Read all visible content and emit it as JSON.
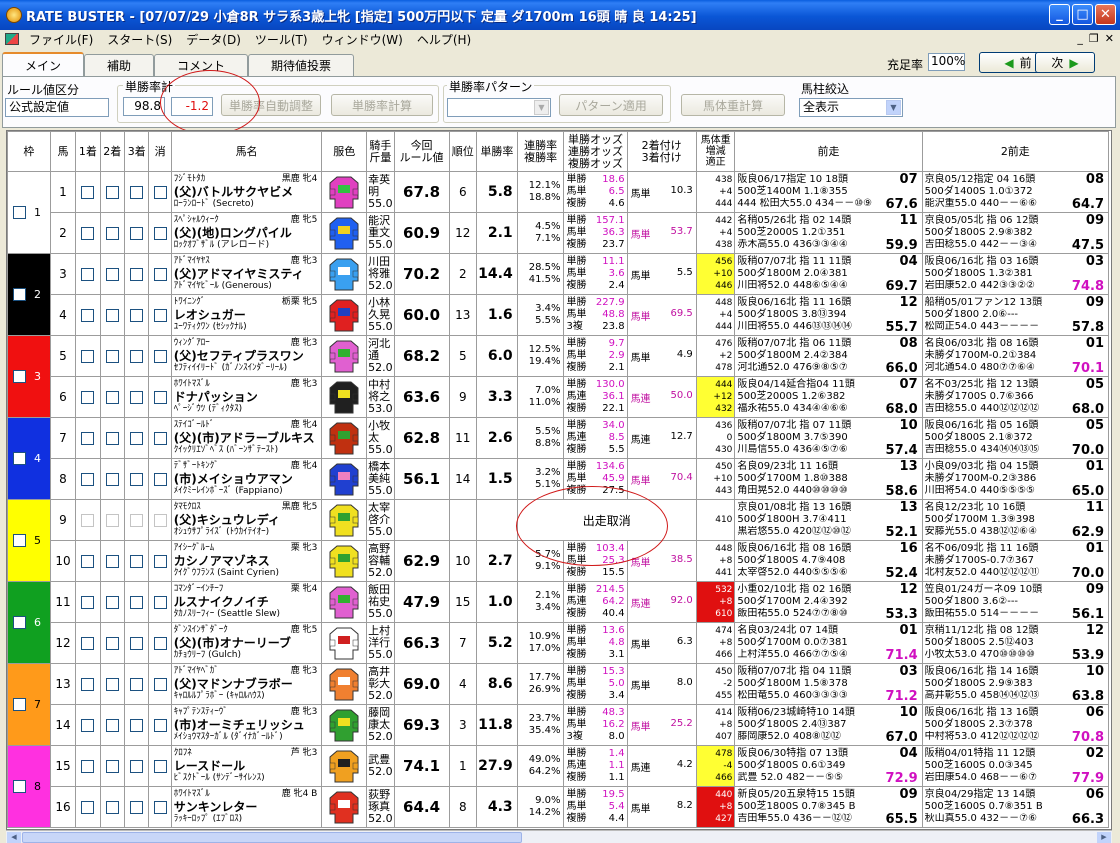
{
  "window": {
    "title": "RATE BUSTER - [07/07/29 小倉8R サラ系3歳上牝 [指定] 500万円以下 定量 ダ1700m 16頭 晴 良 14:25]"
  },
  "menu": [
    "ファイル(F)",
    "スタート(S)",
    "データ(D)",
    "ツール(T)",
    "ウィンドウ(W)",
    "ヘルプ(H)"
  ],
  "tabs": [
    "メイン",
    "補助",
    "コメント",
    "期待値投票"
  ],
  "fill_rate": {
    "label": "充足率",
    "value": "100%"
  },
  "nav": {
    "prev": "前",
    "next": "次"
  },
  "controls": {
    "rule_group_label": "ルール値区分",
    "rule_select": "公式設定値",
    "win_total_label": "単勝率計",
    "win_total": "98.8",
    "win_diff": "-1.2",
    "auto_adjust": "単勝率自動調整",
    "calc": "単勝率計算",
    "pattern_label": "単勝率パターン",
    "pattern_value": "",
    "pattern_apply": "パターン適用",
    "weight_calc": "馬体重計算",
    "filter_label": "馬柱絞込",
    "filter_value": "全表示"
  },
  "headers": {
    "waku": "枠",
    "uma": "馬",
    "p1": "1着",
    "p2": "2着",
    "p3": "3着",
    "kesi": "消",
    "name": "馬名",
    "silk": "服色",
    "jockey": "騎手\n斤量",
    "rule": "今回\nルール値",
    "rank": "順位",
    "win": "単勝率",
    "ren": "連勝率\n複勝率",
    "odds": "単勝オッズ\n連勝オッズ\n複勝オッズ",
    "pair": "2着付け\n3着付け",
    "bw": "馬体重\n増減\n適正",
    "prev1": "前走",
    "prev2": "2前走"
  },
  "scratch_text": "出走取消",
  "horses": [
    {
      "num": "1",
      "owner": "ﾌｼﾞﾓﾄﾀｶ",
      "color": "黒鹿",
      "sex": "牝4",
      "name": "(父)バトルサクヤビメ",
      "sire": "ﾛｰﾗﾝﾛｰﾄﾞ (Secreto)",
      "jockey": "幸英明",
      "kin": "55.0",
      "rule": "67.8",
      "rank": "6",
      "win": "5.8",
      "ren": "12.1%",
      "fuku": "18.8%",
      "o1": "18.6",
      "o2": "6.5",
      "o3": "4.6",
      "l1": "単勝",
      "l2": "馬単",
      "l3": "複勝",
      "pa": "10.3",
      "pb": "",
      "pm": false,
      "bw1": "438",
      "bw2": "+4",
      "bw3": "444",
      "bwc": "",
      "r1a": "阪良06/17指定 10 18頭",
      "r1k": "07",
      "r1b": "500芝1400M 1.1⑧355",
      "r1c": "444 松田大55.0 434－－⑩⑨",
      "r1s": "67.6",
      "r1m": false,
      "r2a": "京良05/12指定 04 16頭",
      "r2k": "08",
      "r2b": "500ダ1400S 1.0①372",
      "r2c": "能沢重55.0 440－－⑥⑥",
      "r2s": "64.7",
      "r2m": false,
      "s": [
        "#e040c0",
        "#30c040",
        "#e040c0"
      ]
    },
    {
      "num": "2",
      "owner": "ｽﾍﾟｼｬﾙｳｨｰｸ",
      "color": "鹿",
      "sex": "牝5",
      "name": "(父)(地)ロングパイル",
      "sire": "ﾛｯｸｵﾌﾞｻﾞﾙ (アレロード)",
      "jockey": "能沢重文",
      "kin": "55.0",
      "rule": "60.9",
      "rank": "12",
      "win": "2.1",
      "ren": "4.5%",
      "fuku": "7.1%",
      "o1": "157.1",
      "o2": "36.3",
      "o3": "23.7",
      "l1": "単勝",
      "l2": "馬単",
      "l3": "複勝",
      "pa": "53.7",
      "pb": "",
      "pm": true,
      "bw1": "442",
      "bw2": "+4",
      "bw3": "438",
      "bwc": "",
      "r1a": "名稍05/26北 指 02 14頭",
      "r1k": "11",
      "r1b": "500芝2000S 1.2①351",
      "r1c": "赤木高55.0 436③③④④",
      "r1s": "59.9",
      "r1m": false,
      "r2a": "京良05/05北 指 06 12頭",
      "r2k": "09",
      "r2b": "500ダ1800S 2.9⑧382",
      "r2c": "吉田稔55.0 442－－③④",
      "r2s": "47.5",
      "r2m": false,
      "s": [
        "#2060f0",
        "#f0d020",
        "#2060f0"
      ]
    },
    {
      "num": "3",
      "owner": "ｱﾄﾞﾏｲﾔﾔｽ",
      "color": "鹿",
      "sex": "牝3",
      "name": "(父)アドマイヤミスティ",
      "sire": "ｱﾄﾞﾏｲﾔﾋﾞｰﾙ (Generous)",
      "jockey": "川田将雅",
      "kin": "52.0",
      "rule": "70.2",
      "rank": "2",
      "win": "14.4",
      "ren": "28.5%",
      "fuku": "41.5%",
      "o1": "11.1",
      "o2": "3.6",
      "o3": "2.4",
      "l1": "単勝",
      "l2": "馬単",
      "l3": "複勝",
      "pa": "5.5",
      "pb": "",
      "pm": false,
      "bw1": "456",
      "bw2": "+10",
      "bw3": "446",
      "bwc": "y",
      "r1a": "阪稍07/07北 指 11 11頭",
      "r1k": "04",
      "r1b": "500ダ1800M 2.0④381",
      "r1c": "川田将52.0 448⑥⑤④④",
      "r1s": "69.7",
      "r1m": false,
      "r2a": "阪良06/16北 指 03 16頭",
      "r2k": "03",
      "r2b": "500ダ1800S 1.3②381",
      "r2c": "岩田康52.0 442③③②②",
      "r2s": "74.8",
      "r2m": true,
      "s": [
        "#3aa0f0",
        "#ffffff",
        "#3aa0f0"
      ]
    },
    {
      "num": "4",
      "owner": "ﾄﾜｲﾆﾝｸﾞ",
      "color": "栃栗",
      "sex": "牝5",
      "name": "レオシュガー",
      "sire": "ﾕｰﾜﾃｨｸﾜﾝ (ｾｼｯｸﾅﾙ)",
      "jockey": "小林久晃",
      "kin": "55.0",
      "rule": "60.0",
      "rank": "13",
      "win": "1.6",
      "ren": "3.4%",
      "fuku": "5.5%",
      "o1": "227.9",
      "o2": "48.8",
      "o3": "23.8",
      "l1": "単勝",
      "l2": "馬単",
      "l3": "3複",
      "pa": "69.5",
      "pb": "",
      "pm": true,
      "bw1": "448",
      "bw2": "+4",
      "bw3": "444",
      "bwc": "",
      "r1a": "阪良06/16北 指 11 16頭",
      "r1k": "12",
      "r1b": "500ダ1800S 3.8⑬394",
      "r1c": "川田将55.0 446⑬⑬⑭⑭",
      "r1s": "55.7",
      "r1m": false,
      "r2a": "船稍05/01ファン12 13頭",
      "r2k": "09",
      "r2b": "500ダ1800 2.0⑥---",
      "r2c": "松岡正54.0 443－－－－",
      "r2s": "57.8",
      "r2m": false,
      "s": [
        "#e02020",
        "#2040c0",
        "#e02020"
      ]
    },
    {
      "num": "5",
      "owner": "ｳｨﾝｸﾞｱﾛｰ",
      "color": "鹿",
      "sex": "牝3",
      "name": "(父)セフティプラスワン",
      "sire": "ｾﾌﾃｨｲｲﾘｰﾄﾞ (ｶﾞﾉﾝｽｲﾝﾀﾞｰﾘｰﾙ)",
      "jockey": "河北通",
      "kin": "52.0",
      "rule": "68.2",
      "rank": "5",
      "win": "6.0",
      "ren": "12.5%",
      "fuku": "19.4%",
      "o1": "9.7",
      "o2": "2.9",
      "o3": "2.1",
      "l1": "単勝",
      "l2": "馬単",
      "l3": "複勝",
      "pa": "4.9",
      "pb": "",
      "pm": false,
      "bw1": "476",
      "bw2": "+2",
      "bw3": "478",
      "bwc": "",
      "r1a": "阪稍07/07北 指 06 11頭",
      "r1k": "08",
      "r1b": "500ダ1800M 2.4②384",
      "r1c": "河北通52.0 476⑨⑧⑤⑦",
      "r1s": "66.0",
      "r1m": false,
      "r2a": "名良06/03北 指 08 16頭",
      "r2k": "01",
      "r2b": "未勝ダ1700M-0.2①384",
      "r2c": "河北通54.0 480⑦⑦⑥④",
      "r2s": "70.1",
      "r2m": true,
      "s": [
        "#e060d0",
        "#30b030",
        "#e060d0"
      ]
    },
    {
      "num": "6",
      "owner": "ﾎﾜｲﾄﾏｽﾞﾙ",
      "color": "鹿",
      "sex": "牝3",
      "name": "ドナパッション",
      "sire": "ﾍﾟｰｼﾞｳﾂ (ﾃﾞｨｸﾀｽ)",
      "jockey": "中村将之",
      "kin": "53.0",
      "rule": "63.6",
      "rank": "9",
      "win": "3.3",
      "ren": "7.0%",
      "fuku": "11.0%",
      "o1": "130.0",
      "o2": "36.1",
      "o3": "22.1",
      "l1": "単勝",
      "l2": "馬連",
      "l3": "複勝",
      "pa": "50.0",
      "pb": "",
      "pm": true,
      "bw1": "444",
      "bw2": "+12",
      "bw3": "432",
      "bwc": "y",
      "r1a": "阪良04/14延合指04 11頭",
      "r1k": "07",
      "r1b": "500芝2000S 1.2⑥382",
      "r1c": "福永祐55.0 434④④⑥⑥",
      "r1s": "68.0",
      "r1m": false,
      "r2a": "名不03/25北 指 12 13頭",
      "r2k": "05",
      "r2b": "未勝ダ1700S 0.7⑥366",
      "r2c": "吉田稔55.0 440⑫⑫⑫⑫",
      "r2s": "68.0",
      "r2m": false,
      "s": [
        "#202020",
        "#f0e020",
        "#202020"
      ]
    },
    {
      "num": "7",
      "owner": "ｽﾃｲｺﾞｰﾙﾄﾞ",
      "color": "鹿",
      "sex": "牝4",
      "name": "(父)(市)アドラーブルキス",
      "sire": "ｸｲｯｸﾘｴｿﾞﾍﾞｽ (ﾊﾞｰﾝｻﾞﾃｰｽﾄ)",
      "jockey": "小牧太",
      "kin": "55.0",
      "rule": "62.8",
      "rank": "11",
      "win": "2.6",
      "ren": "5.5%",
      "fuku": "8.8%",
      "o1": "34.0",
      "o2": "8.5",
      "o3": "5.5",
      "l1": "単勝",
      "l2": "馬連",
      "l3": "複勝",
      "pa": "12.7",
      "pb": "",
      "pm": false,
      "bw1": "436",
      "bw2": "0",
      "bw3": "430",
      "bwc": "",
      "r1a": "阪稍07/07北 指 07 11頭",
      "r1k": "10",
      "r1b": "500ダ1800M 3.7⑤390",
      "r1c": "川島信55.0 436④⑤⑦⑥",
      "r1s": "57.4",
      "r1m": false,
      "r2a": "阪良06/16北 指 05 16頭",
      "r2k": "05",
      "r2b": "500ダ1800S 2.1⑧372",
      "r2c": "吉田稔55.0 434⑭⑭⑬⑮",
      "r2s": "70.0",
      "r2m": false,
      "s": [
        "#c03010",
        "#30a030",
        "#c03010"
      ]
    },
    {
      "num": "8",
      "owner": "ﾃﾞｻﾞｰﾄｷﾝｸﾞ",
      "color": "鹿",
      "sex": "牝4",
      "name": "(市)メイショウアマン",
      "sire": "ﾒｲｸﾐｰﾚｲﾝﾎﾞｰｽﾞ (Fappiano)",
      "jockey": "橋本美純",
      "kin": "55.0",
      "rule": "56.1",
      "rank": "14",
      "win": "1.5",
      "ren": "3.2%",
      "fuku": "5.1%",
      "o1": "134.6",
      "o2": "45.9",
      "o3": "27.5",
      "l1": "単勝",
      "l2": "馬単",
      "l3": "複勝",
      "pa": "70.4",
      "pb": "",
      "pm": true,
      "bw1": "450",
      "bw2": "+10",
      "bw3": "443",
      "bwc": "",
      "r1a": "名良09/23北 11 16頭",
      "r1k": "13",
      "r1b": "500ダ1700M 1.8⑩388",
      "r1c": "角田晃52.0 440⑩⑩⑩⑩",
      "r1s": "58.6",
      "r1m": false,
      "r2a": "小良09/03北 指 04 15頭",
      "r2k": "01",
      "r2b": "未勝ダ1700M-0.2③386",
      "r2c": "川田将54.0 440⑤⑤⑤⑤",
      "r2s": "65.0",
      "r2m": false,
      "s": [
        "#2040d0",
        "#f080c0",
        "#2040d0"
      ]
    },
    {
      "num": "9",
      "owner": "ﾀﾏﾓｸﾛｽ",
      "color": "黒鹿",
      "sex": "牝5",
      "name": "(父)キシュウレディ",
      "sire": "ｵｼｭｳｻﾌﾟﾗｲｽﾞ (ﾄｳｶｲﾃｲｵｰ)",
      "jockey": "太宰啓介",
      "kin": "55.0",
      "scratched": true,
      "bw1": "",
      "bw2": "",
      "bw3": "410",
      "bwc": "",
      "r1a": "京良01/08北 指 13 16頭",
      "r1k": "13",
      "r1b": "500ダ1800H 3.7④411",
      "r1c": "黒岩悠55.0 420⑫⑫⑩⑫",
      "r1s": "52.1",
      "r1m": false,
      "r2a": "名良12/23北 10 16頭",
      "r2k": "11",
      "r2b": "500ダ1700M 1.3⑨398",
      "r2c": "安藤光55.0 438⑫⑫⑥④",
      "r2s": "62.9",
      "r2m": false,
      "s": [
        "#f0e020",
        "#30a030",
        "#f0e020"
      ]
    },
    {
      "num": "10",
      "owner": "ｱｲｼｰｸﾞﾙｰﾑ",
      "color": "栗",
      "sex": "牝3",
      "name": "カシノアマゾネス",
      "sire": "ｸｲｸﾞｳﾌﾗﾝｽ (Saint Cyrien)",
      "jockey": "高野容輔",
      "kin": "52.0",
      "rule": "62.9",
      "rank": "10",
      "win": "2.7",
      "ren": "5.7%",
      "fuku": "9.1%",
      "o1": "103.4",
      "o2": "25.3",
      "o3": "15.5",
      "l1": "単勝",
      "l2": "馬単",
      "l3": "複勝",
      "pa": "38.5",
      "pb": "",
      "pm": true,
      "bw1": "448",
      "bw2": "+8",
      "bw3": "441",
      "bwc": "",
      "r1a": "阪良06/16北 指 08 16頭",
      "r1k": "16",
      "r1b": "500ダ1800S 4.7⑨408",
      "r1c": "太宰啓52.0 440⑤⑤⑤⑥",
      "r1s": "52.4",
      "r1m": false,
      "r2a": "名不06/09北 指 11 16頭",
      "r2k": "01",
      "r2b": "未勝ダ1700S-0.7⑦367",
      "r2c": "北村友52.0 440⑫⑫⑫⑪",
      "r2s": "70.0",
      "r2m": false,
      "s": [
        "#f0e020",
        "#30a030",
        "#f0e020"
      ]
    },
    {
      "num": "11",
      "owner": "ｺﾏﾝﾀﾞｰｲﾝﾁｰﾌ",
      "color": "栗",
      "sex": "牝4",
      "name": "ルスナイクノイチ",
      "sire": "ﾀｶﾉｽﾘｰﾌｨｰ (Seattle Slew)",
      "jockey": "飯田祐史",
      "kin": "55.0",
      "rule": "47.9",
      "rank": "15",
      "win": "1.0",
      "ren": "2.1%",
      "fuku": "3.4%",
      "o1": "214.5",
      "o2": "64.2",
      "o3": "40.4",
      "l1": "単勝",
      "l2": "馬連",
      "l3": "複勝",
      "pa": "92.0",
      "pb": "",
      "pm": true,
      "bw1": "532",
      "bw2": "+8",
      "bw3": "610",
      "bwc": "r",
      "r1a": "小重02/10北 指 02 16頭",
      "r1k": "12",
      "r1b": "500ダ1700M 2.4④392",
      "r1c": "飯田祐55.0 524⑦⑦⑧⑩",
      "r1s": "53.3",
      "r1m": false,
      "r2a": "笠良01/24ガーネ09 10頭",
      "r2k": "09",
      "r2b": "500ダ1800 3.6②---",
      "r2c": "飯田祐55.0 514－－－－",
      "r2s": "56.1",
      "r2m": false,
      "s": [
        "#e060d0",
        "#30b030",
        "#e060d0"
      ]
    },
    {
      "num": "12",
      "owner": "ﾀﾞﾝｽｲﾝｻﾞﾀﾞｰｸ",
      "color": "鹿",
      "sex": "牝5",
      "name": "(父)(市)オナーリーブ",
      "sire": "ｶﾁｮｳﾘｰﾌ (Gulch)",
      "jockey": "上村洋行",
      "kin": "55.0",
      "rule": "66.3",
      "rank": "7",
      "win": "5.2",
      "ren": "10.9%",
      "fuku": "17.0%",
      "o1": "13.6",
      "o2": "4.8",
      "o3": "3.1",
      "l1": "単勝",
      "l2": "馬単",
      "l3": "複勝",
      "pa": "6.3",
      "pb": "",
      "pm": false,
      "bw1": "474",
      "bw2": "+8",
      "bw3": "466",
      "bwc": "",
      "r1a": "名良03/24北 07 14頭",
      "r1k": "01",
      "r1b": "500ダ1700M 0.0⑦381",
      "r1c": "上村洋55.0 466⑦⑦⑤④",
      "r1s": "71.4",
      "r1m": true,
      "r2a": "京稍11/12北 指 08 12頭",
      "r2k": "12",
      "r2b": "500ダ1800S 2.5⑫403",
      "r2c": "小牧太53.0 470⑩⑩⑩⑩",
      "r2s": "53.9",
      "r2m": false,
      "s": [
        "#ffffff",
        "#d02020",
        "#ffffff"
      ]
    },
    {
      "num": "13",
      "owner": "ｱﾄﾞﾏｲﾔﾍﾞｶﾞ",
      "color": "鹿",
      "sex": "牝3",
      "name": "(父)マドンナブラボー",
      "sire": "ｷｬﾛﾙﾙﾌﾟﾗﾎﾞｰ (ｷｬﾛﾙﾊｳｽ)",
      "jockey": "高井彰大",
      "kin": "52.0",
      "rule": "69.0",
      "rank": "4",
      "win": "8.6",
      "ren": "17.7%",
      "fuku": "26.9%",
      "o1": "15.3",
      "o2": "5.0",
      "o3": "3.4",
      "l1": "単勝",
      "l2": "馬単",
      "l3": "複勝",
      "pa": "8.0",
      "pb": "",
      "pm": false,
      "bw1": "450",
      "bw2": "-2",
      "bw3": "455",
      "bwc": "",
      "r1a": "阪稍07/07北 指 04 11頭",
      "r1k": "03",
      "r1b": "500ダ1800M 1.5⑧378",
      "r1c": "松田竜55.0 460③③③③",
      "r1s": "71.2",
      "r1m": true,
      "r2a": "阪良06/16北 指 14 16頭",
      "r2k": "10",
      "r2b": "500ダ1800S 2.9⑨383",
      "r2c": "高井彰55.0 458⑭⑭⑫⑬",
      "r2s": "63.8",
      "r2m": false,
      "s": [
        "#f08030",
        "#ffffff",
        "#f08030"
      ]
    },
    {
      "num": "14",
      "owner": "ｷｬﾌﾟﾃﾝｽﾃｨｰｳﾞ",
      "color": "鹿",
      "sex": "牝3",
      "name": "(市)オーミチェリッシュ",
      "sire": "ﾒｲｼｮｳﾏｽﾀｰｶﾞﾙ (ﾀﾞｲﾅｶﾞｰﾙﾄﾞ)",
      "jockey": "藤岡康太",
      "kin": "52.0",
      "rule": "69.3",
      "rank": "3",
      "win": "11.8",
      "ren": "23.7%",
      "fuku": "35.4%",
      "o1": "48.3",
      "o2": "16.2",
      "o3": "8.0",
      "l1": "単勝",
      "l2": "馬単",
      "l3": "3複",
      "pa": "25.2",
      "pb": "",
      "pm": true,
      "bw1": "414",
      "bw2": "+8",
      "bw3": "407",
      "bwc": "",
      "r1a": "阪稍06/23城崎特10 14頭",
      "r1k": "10",
      "r1b": "500ダ1800S 2.4⑬387",
      "r1c": "藤岡康52.0 408⑧⑫⑫",
      "r1s": "67.0",
      "r1m": false,
      "r2a": "阪良06/16北 指 13 16頭",
      "r2k": "06",
      "r2b": "500ダ1800S 2.3⑦378",
      "r2c": "中村将53.0 412⑫⑫⑫⑫",
      "r2s": "70.8",
      "r2m": true,
      "s": [
        "#30a030",
        "#f0e020",
        "#30a030"
      ]
    },
    {
      "num": "15",
      "owner": "ｸﾛﾌﾈ",
      "color": "芦",
      "sex": "牝3",
      "name": "レースドール",
      "sire": "ﾋﾞｽｸﾄﾞｰﾙ (ｻﾝﾃﾞｰｻｲﾚﾝｽ)",
      "jockey": "武豊",
      "kin": "52.0",
      "rule": "74.1",
      "rank": "1",
      "win": "27.9",
      "ren": "49.0%",
      "fuku": "64.2%",
      "o1": "1.4",
      "o2": "1.1",
      "o3": "1.1",
      "l1": "単勝",
      "l2": "馬連",
      "l3": "複勝",
      "pa": "4.2",
      "pb": "",
      "pm": false,
      "bw1": "478",
      "bw2": "-4",
      "bw3": "466",
      "bwc": "y",
      "r1a": "阪良06/30特指 07 13頭",
      "r1k": "04",
      "r1b": "500ダ1800S 0.6①349",
      "r1c": "武豊 52.0 482－－⑤⑤",
      "r1s": "72.9",
      "r1m": true,
      "r2a": "阪稍04/01特指 11 12頭",
      "r2k": "02",
      "r2b": "500芝1600S 0.0③345",
      "r2c": "岩田康54.0 468－－⑥⑦",
      "r2s": "77.9",
      "r2m": true,
      "s": [
        "#f0a020",
        "#202020",
        "#f0a020"
      ]
    },
    {
      "num": "16",
      "owner": "ﾎﾜｲﾄﾏｽﾞﾙ",
      "color": "鹿",
      "sex": "牝4 B",
      "name": "サンキンレター",
      "sire": "ﾗｯｷｰﾛｯﾌﾟ (ｴﾌﾞﾛｽ)",
      "jockey": "荻野琢真",
      "kin": "52.0",
      "rule": "64.4",
      "rank": "8",
      "win": "4.3",
      "ren": "9.0%",
      "fuku": "14.2%",
      "o1": "19.5",
      "o2": "5.4",
      "o3": "4.4",
      "l1": "単勝",
      "l2": "馬単",
      "l3": "複勝",
      "pa": "8.2",
      "pb": "",
      "pm": false,
      "bw1": "440",
      "bw2": "+8",
      "bw3": "427",
      "bwc": "r",
      "r1a": "新良05/20五泉特15 15頭",
      "r1k": "09",
      "r1b": "500芝1800S 0.7⑧345 B",
      "r1c": "吉田隼55.0 436－－⑫⑫",
      "r1s": "65.5",
      "r1m": false,
      "r2a": "京良04/29指定 13 14頭",
      "r2k": "06",
      "r2b": "500芝1600S 0.7⑧351 B",
      "r2c": "秋山真55.0 432－－⑦⑥",
      "r2s": "66.3",
      "r2m": false,
      "s": [
        "#e03020",
        "#ffffff",
        "#e03020"
      ]
    }
  ],
  "waku": [
    {
      "label": "1",
      "color": "#ffffff",
      "fg": "#000"
    },
    {
      "label": "2",
      "color": "#000000",
      "fg": "#ffffff"
    },
    {
      "label": "3",
      "color": "#f01010",
      "fg": "#ffffff"
    },
    {
      "label": "4",
      "color": "#1030e0",
      "fg": "#ffffff"
    },
    {
      "label": "5",
      "color": "#ffff00",
      "fg": "#000"
    },
    {
      "label": "6",
      "color": "#10a020",
      "fg": "#ffffff"
    },
    {
      "label": "7",
      "color": "#ff9a1a",
      "fg": "#000"
    },
    {
      "label": "8",
      "color": "#ff30e0",
      "fg": "#000"
    }
  ]
}
